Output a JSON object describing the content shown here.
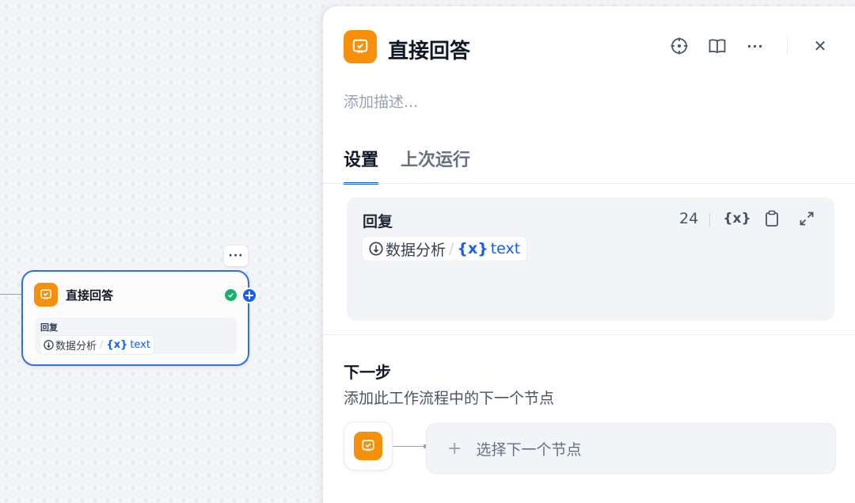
{
  "canvas": {
    "node": {
      "title": "直接回答",
      "more_label": "···",
      "body_label": "回复",
      "chip_source": "数据分析",
      "chip_separator": "/",
      "chip_var_icon": "{x}",
      "chip_var": "text",
      "add_label": "+"
    }
  },
  "panel": {
    "title": "直接回答",
    "description_placeholder": "添加描述...",
    "tools": [
      "locate-icon",
      "docs-icon",
      "more-icon",
      "close-icon"
    ],
    "more_label": "···",
    "close_label": "✕",
    "tabs": [
      {
        "label": "设置",
        "active": true
      },
      {
        "label": "上次运行",
        "active": false
      }
    ],
    "reply": {
      "label": "回复",
      "char_count": "24",
      "var_button": "{x}",
      "chip_source": "数据分析",
      "chip_separator": "/",
      "chip_var_icon": "{x}",
      "chip_var": "text"
    },
    "next_step": {
      "title": "下一步",
      "description": "添加此工作流程中的下一个节点",
      "plus": "+",
      "select_label": "选择下一个节点"
    }
  },
  "colors": {
    "accent": "#155eef",
    "node_icon": "#f79009",
    "success": "#17b26a"
  }
}
